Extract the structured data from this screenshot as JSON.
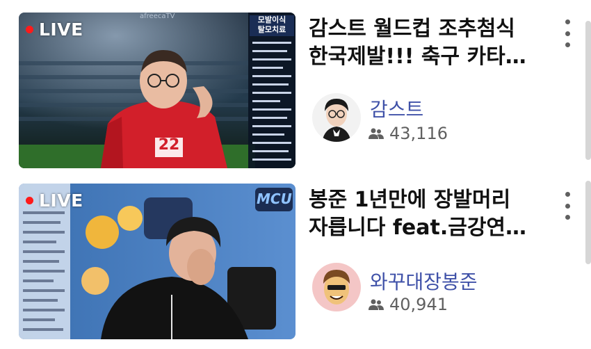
{
  "videos": [
    {
      "live_label": "LIVE",
      "title_lines": [
        "감스트 월드컵 조추첨식",
        "한국제발!!! 축구 카타…"
      ],
      "channel": "감스트",
      "viewers": "43,116",
      "overlay_small": "afreecaTV",
      "overlay_tag_lines": [
        "모발이식",
        "탈모치료"
      ],
      "jersey_number": "22"
    },
    {
      "live_label": "LIVE",
      "title_lines": [
        "봉준 1년만에 장발머리",
        "자릅니다 feat.금강연…"
      ],
      "channel": "와꾸대장봉준",
      "viewers": "40,941",
      "overlay_logo": "MCU"
    }
  ],
  "colors": {
    "live_dot": "#ff1a1a",
    "channel_link": "#3f51a8",
    "meta_gray": "#606060"
  },
  "icons": [
    "kebab-menu-icon",
    "viewers-icon"
  ]
}
